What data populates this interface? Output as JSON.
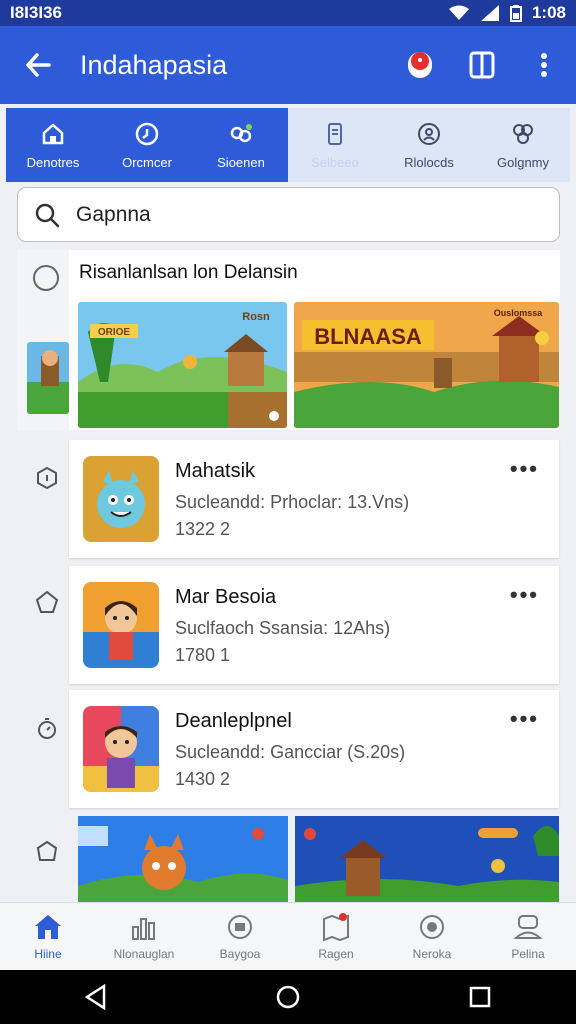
{
  "status_bar": {
    "time_left": "I8I3I36",
    "time_right": "1:08"
  },
  "app_bar": {
    "title": "Indahapasia"
  },
  "categories": [
    {
      "label": "Denotres",
      "icon": "home-icon",
      "state": "active"
    },
    {
      "label": "Orcmcer",
      "icon": "clock-icon",
      "state": "active"
    },
    {
      "label": "Sioenen",
      "icon": "people-icon",
      "state": "active"
    },
    {
      "label": "Selbeeo",
      "icon": "phone-icon",
      "state": "muted"
    },
    {
      "label": "Rlolocds",
      "icon": "badge-icon",
      "state": "normal"
    },
    {
      "label": "Golgnmy",
      "icon": "group-icon",
      "state": "normal"
    }
  ],
  "search": {
    "value": "Gapnna"
  },
  "featured": {
    "heading": "Risanlanlsan lon Delansin",
    "banners": [
      {
        "label": "ORIOE",
        "tag": "Rosn"
      },
      {
        "label": "BLNAASA",
        "tag": "Ouslomssa"
      }
    ]
  },
  "apps": [
    {
      "name": "Mahatsik",
      "subtitle": "Sucleandd: Prhoclar: 13.Vns)",
      "number": "1322 2"
    },
    {
      "name": "Mar Besoia",
      "subtitle": "Suclfaoch Ssansia: 12Ahs)",
      "number": "1780 1"
    },
    {
      "name": "Deanleplpnel",
      "subtitle": "Sucleandd: Gancciar (S.20s)",
      "number": "1430 2"
    }
  ],
  "bottom_nav": [
    {
      "label": "Hiine",
      "icon": "home-icon",
      "active": true
    },
    {
      "label": "Nlonauglan",
      "icon": "chart-icon",
      "active": false
    },
    {
      "label": "Baygoa",
      "icon": "puzzle-icon",
      "active": false
    },
    {
      "label": "Ragen",
      "icon": "map-icon",
      "active": false
    },
    {
      "label": "Neroka",
      "icon": "target-icon",
      "active": false
    },
    {
      "label": "Pelina",
      "icon": "person-icon",
      "active": false
    }
  ],
  "colors": {
    "primary": "#2e5bd8",
    "status_bar": "#1d3a9c",
    "background": "#eef0f4"
  }
}
